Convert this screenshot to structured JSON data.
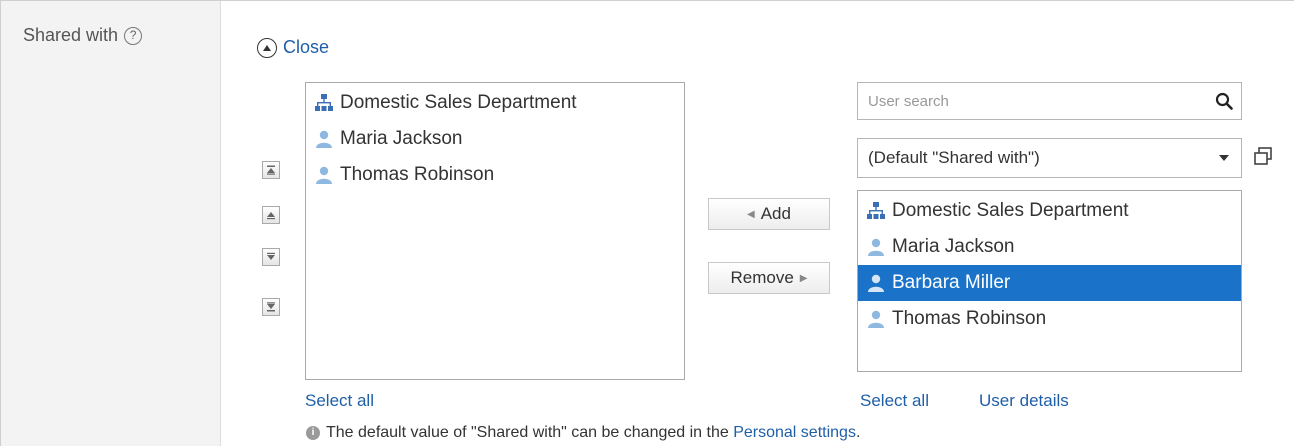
{
  "field": {
    "label": "Shared with",
    "help_icon": "question-circle-icon"
  },
  "toggle": {
    "label": "Close",
    "icon": "chevron-up-circle-icon"
  },
  "order_buttons": [
    {
      "name": "move-to-top-button",
      "icon": "move-to-top-icon"
    },
    {
      "name": "move-up-button",
      "icon": "move-up-icon"
    },
    {
      "name": "move-down-button",
      "icon": "move-down-icon"
    },
    {
      "name": "move-to-bottom-button",
      "icon": "move-to-bottom-icon"
    }
  ],
  "shared_list": {
    "items": [
      {
        "label": "Domestic Sales Department",
        "type": "organization"
      },
      {
        "label": "Maria Jackson",
        "type": "user"
      },
      {
        "label": "Thomas Robinson",
        "type": "user"
      }
    ],
    "select_all": "Select all"
  },
  "actions": {
    "add": "Add",
    "remove": "Remove"
  },
  "search": {
    "placeholder": "User search",
    "icon": "search-icon"
  },
  "group_select": {
    "value": "(Default \"Shared with\")",
    "popup_icon": "popup-window-icon"
  },
  "candidate_list": {
    "items": [
      {
        "label": "Domestic Sales Department",
        "type": "organization",
        "selected": false
      },
      {
        "label": "Maria Jackson",
        "type": "user",
        "selected": false
      },
      {
        "label": "Barbara Miller",
        "type": "user",
        "selected": true
      },
      {
        "label": "Thomas Robinson",
        "type": "user",
        "selected": false
      }
    ],
    "select_all": "Select all",
    "user_details": "User details"
  },
  "note": {
    "text": "The default value of \"Shared with\" can be changed in the",
    "link": "Personal settings",
    "suffix": "."
  },
  "colors": {
    "link": "#1f5fa8",
    "selection": "#1a73c9",
    "user_icon": "#8fb8e0",
    "org_icon": "#3a6fb5"
  }
}
